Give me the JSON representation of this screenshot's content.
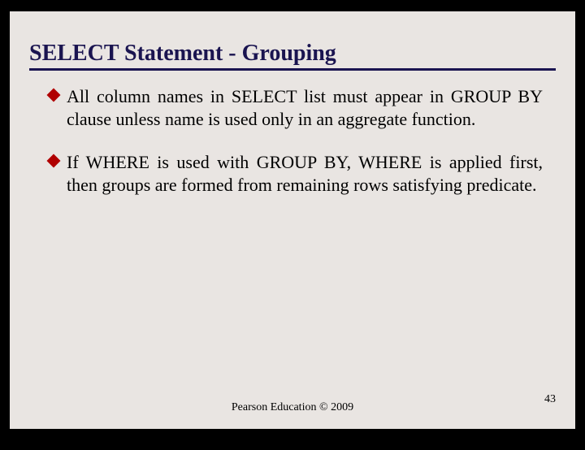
{
  "title": "SELECT Statement - Grouping",
  "bullets": [
    "All column names in SELECT list must appear in GROUP BY clause unless name is used only in an aggregate function.",
    "If WHERE is used with GROUP BY, WHERE is applied first, then groups are formed from remaining rows satisfying predicate."
  ],
  "footer": "Pearson Education © 2009",
  "page_number": "43"
}
